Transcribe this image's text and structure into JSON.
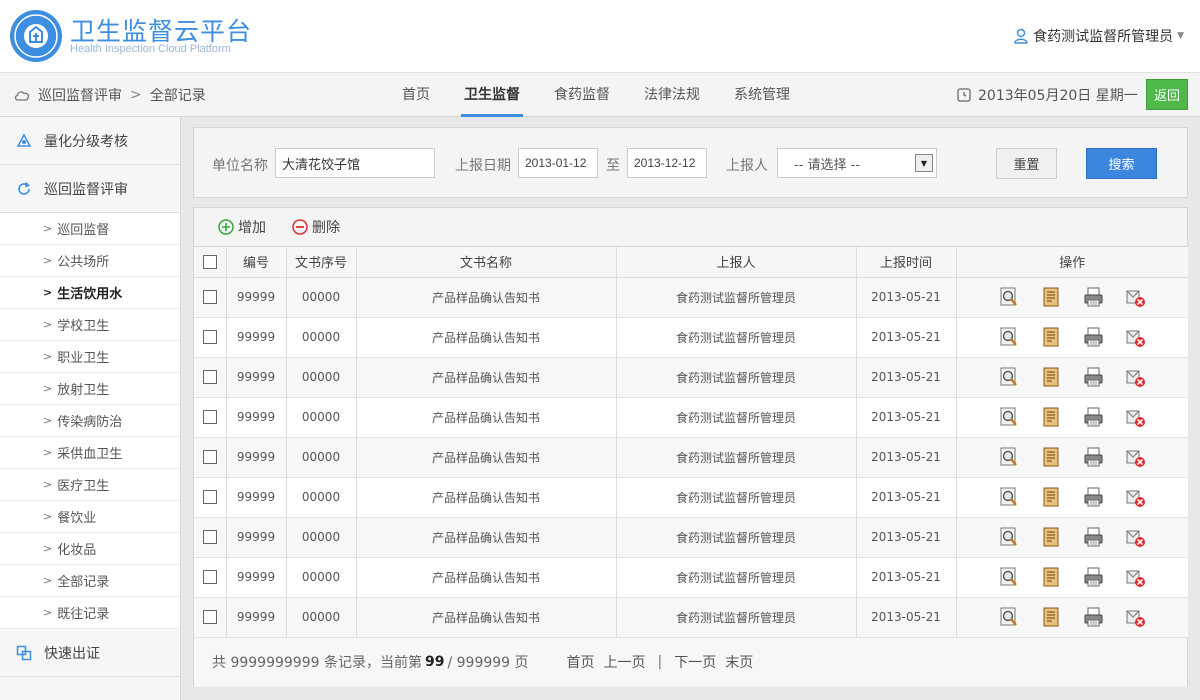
{
  "header": {
    "title": "卫生监督云平台",
    "subtitle": "Health Inspection Cloud Platform",
    "user_name": "食药测试监督所管理员"
  },
  "breadcrumb": [
    "巡回监督评审",
    "全部记录"
  ],
  "nav": {
    "items": [
      {
        "label": "首页",
        "active": false
      },
      {
        "label": "卫生监督",
        "active": true
      },
      {
        "label": "食药监督",
        "active": false
      },
      {
        "label": "法律法规",
        "active": false
      },
      {
        "label": "系统管理",
        "active": false
      }
    ],
    "date": "2013年05月20日 星期一",
    "back_label": "返回"
  },
  "sidebar": {
    "group1": "量化分级考核",
    "group2": "巡回监督评审",
    "sub_items": [
      {
        "label": "巡回监督",
        "active": false
      },
      {
        "label": "公共场所",
        "active": false
      },
      {
        "label": "生活饮用水",
        "active": true
      },
      {
        "label": "学校卫生",
        "active": false
      },
      {
        "label": "职业卫生",
        "active": false
      },
      {
        "label": "放射卫生",
        "active": false
      },
      {
        "label": "传染病防治",
        "active": false
      },
      {
        "label": "采供血卫生",
        "active": false
      },
      {
        "label": "医疗卫生",
        "active": false
      },
      {
        "label": "餐饮业",
        "active": false
      },
      {
        "label": "化妆品",
        "active": false
      },
      {
        "label": "全部记录",
        "active": false
      },
      {
        "label": "既往记录",
        "active": false
      }
    ],
    "group3": "快速出证"
  },
  "search": {
    "unit_label": "单位名称",
    "unit_value": "大清花饺子馆",
    "date_label": "上报日期",
    "date_from": "2013-01-12",
    "date_to_label": "至",
    "date_to": "2013-12-12",
    "reporter_label": "上报人",
    "reporter_value": "-- 请选择 --",
    "reset_label": "重置",
    "search_label": "搜索"
  },
  "toolbar": {
    "add_label": "增加",
    "delete_label": "删除"
  },
  "table": {
    "columns": [
      "编号",
      "文书序号",
      "文书名称",
      "上报人",
      "上报时间",
      "操作"
    ],
    "rows": [
      {
        "id": "99999",
        "seq": "00000",
        "name": "产品样品确认告知书",
        "reporter": "食药测试监督所管理员",
        "time": "2013-05-21"
      },
      {
        "id": "99999",
        "seq": "00000",
        "name": "产品样品确认告知书",
        "reporter": "食药测试监督所管理员",
        "time": "2013-05-21"
      },
      {
        "id": "99999",
        "seq": "00000",
        "name": "产品样品确认告知书",
        "reporter": "食药测试监督所管理员",
        "time": "2013-05-21"
      },
      {
        "id": "99999",
        "seq": "00000",
        "name": "产品样品确认告知书",
        "reporter": "食药测试监督所管理员",
        "time": "2013-05-21"
      },
      {
        "id": "99999",
        "seq": "00000",
        "name": "产品样品确认告知书",
        "reporter": "食药测试监督所管理员",
        "time": "2013-05-21"
      },
      {
        "id": "99999",
        "seq": "00000",
        "name": "产品样品确认告知书",
        "reporter": "食药测试监督所管理员",
        "time": "2013-05-21"
      },
      {
        "id": "99999",
        "seq": "00000",
        "name": "产品样品确认告知书",
        "reporter": "食药测试监督所管理员",
        "time": "2013-05-21"
      },
      {
        "id": "99999",
        "seq": "00000",
        "name": "产品样品确认告知书",
        "reporter": "食药测试监督所管理员",
        "time": "2013-05-21"
      },
      {
        "id": "99999",
        "seq": "00000",
        "name": "产品样品确认告知书",
        "reporter": "食药测试监督所管理员",
        "time": "2013-05-21"
      }
    ]
  },
  "pager": {
    "prefix": "共 9999999999 条记录，当前第",
    "current": "99",
    "total": "/ 999999 页",
    "first": "首页",
    "prev": "上一页",
    "sep": "|",
    "next": "下一页",
    "last": "末页"
  },
  "colors": {
    "brand": "#3d8ee0",
    "search_button": "#3c86e0",
    "back_button": "#4eb848",
    "add_icon": "#3aa53a",
    "delete_icon": "#e03030"
  },
  "icons": {
    "op_icons": [
      "view-icon",
      "edit-document-icon",
      "print-icon",
      "delete-record-icon"
    ]
  }
}
